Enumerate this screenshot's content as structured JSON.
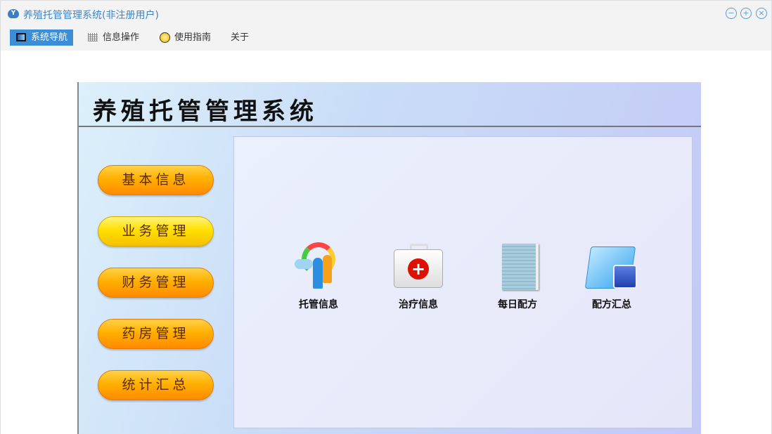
{
  "window": {
    "title": "养殖托管管理系统(非注册用户)",
    "controls": [
      "minimize",
      "maximize",
      "close"
    ]
  },
  "menubar": [
    {
      "label": "系统导航",
      "icon": "monitor-icon",
      "active": true
    },
    {
      "label": "信息操作",
      "icon": "grid-icon"
    },
    {
      "label": "使用指南",
      "icon": "help-icon"
    },
    {
      "label": "关于"
    }
  ],
  "panel": {
    "title": "养殖托管管理系统",
    "nav": [
      {
        "label": "基本信息"
      },
      {
        "label": "业务管理"
      },
      {
        "label": "财务管理"
      },
      {
        "label": "药房管理"
      },
      {
        "label": "统计汇总"
      }
    ],
    "tiles": [
      {
        "label": "托管信息",
        "icon": "people-rainbow-icon"
      },
      {
        "label": "治疗信息",
        "icon": "first-aid-kit-icon"
      },
      {
        "label": "每日配方",
        "icon": "document-icon"
      },
      {
        "label": "配方汇总",
        "icon": "folder-icon"
      }
    ]
  }
}
